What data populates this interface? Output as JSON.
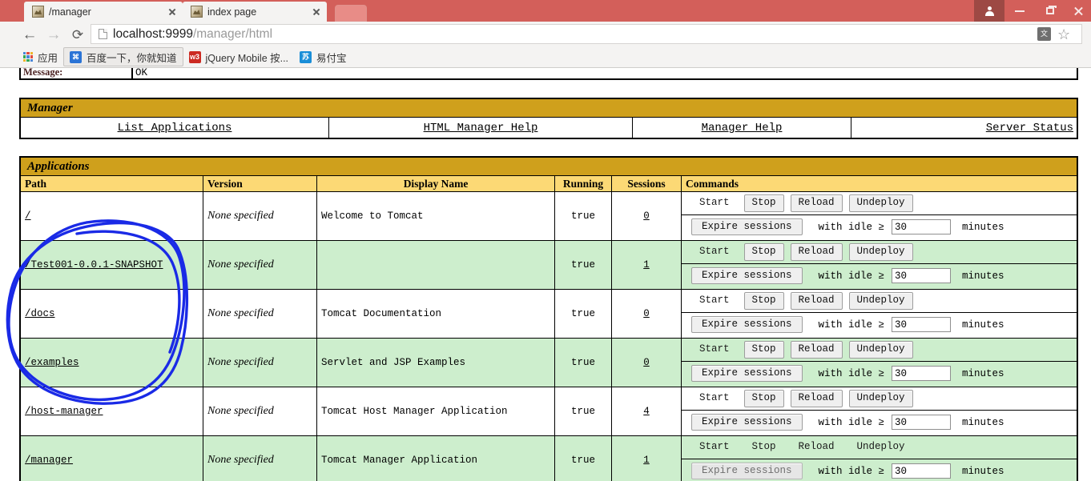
{
  "browser": {
    "tabs": [
      {
        "title": "/manager",
        "favicon": "tomcat-favicon",
        "active": true
      },
      {
        "title": "index page",
        "favicon": "tomcat-favicon",
        "active": false
      }
    ],
    "nav": {
      "back_icon": "back-arrow-icon",
      "forward_icon": "forward-arrow-icon",
      "reload_icon": "reload-icon",
      "back_glyph": "←",
      "forward_glyph": "→",
      "reload_glyph": "⟳"
    },
    "omnibox": {
      "url_host": "localhost:9999",
      "url_path": "/manager/html",
      "page_icon": "document-icon",
      "translate_icon": "translate-icon",
      "star_icon": "bookmark-star-icon",
      "star_glyph": "☆"
    },
    "window_controls": {
      "user_icon": "user-avatar-icon",
      "minimize_icon": "minimize-icon",
      "maximize_icon": "maximize-icon",
      "close_icon": "close-icon"
    },
    "bookmarks": [
      {
        "label": "应用",
        "icon": "apps-grid-icon",
        "badge": ""
      },
      {
        "label": "百度一下，你就知道",
        "icon": "baidu-favicon",
        "badge": "⌘"
      },
      {
        "label": "jQuery Mobile 按...",
        "icon": "w3school-favicon",
        "badge": "w3"
      },
      {
        "label": "易付宝",
        "icon": "yifubao-favicon",
        "badge": "苏"
      }
    ]
  },
  "page": {
    "message_row": {
      "label": "Message:",
      "value": "OK"
    },
    "manager_section": {
      "title": "Manager",
      "links": [
        {
          "label": "List Applications",
          "align": "center"
        },
        {
          "label": "HTML Manager Help",
          "align": "center"
        },
        {
          "label": "Manager Help",
          "align": "center"
        },
        {
          "label": "Server Status",
          "align": "right"
        }
      ]
    },
    "applications_section": {
      "title": "Applications",
      "columns": [
        "Path",
        "Version",
        "Display Name",
        "Running",
        "Sessions",
        "Commands"
      ],
      "commands_labels": {
        "start": "Start",
        "stop": "Stop",
        "reload": "Reload",
        "undeploy": "Undeploy",
        "expire": "Expire sessions",
        "with_idle": "with idle ≥",
        "idle_value": "30",
        "minutes": "minutes"
      },
      "rows": [
        {
          "path": "/",
          "version": "None specified",
          "display_name": "Welcome to Tomcat",
          "running": "true",
          "sessions": "0",
          "stripe": "white",
          "start_enabled": false,
          "stop_enabled": true,
          "reload_enabled": true,
          "undeploy_enabled": true,
          "expire_enabled": true,
          "idle_value": "30"
        },
        {
          "path": "/Test001-0.0.1-SNAPSHOT",
          "version": "None specified",
          "display_name": "",
          "running": "true",
          "sessions": "1",
          "stripe": "green",
          "start_enabled": false,
          "stop_enabled": true,
          "reload_enabled": true,
          "undeploy_enabled": true,
          "expire_enabled": true,
          "idle_value": "30"
        },
        {
          "path": "/docs",
          "version": "None specified",
          "display_name": "Tomcat Documentation",
          "running": "true",
          "sessions": "0",
          "stripe": "white",
          "start_enabled": false,
          "stop_enabled": true,
          "reload_enabled": true,
          "undeploy_enabled": true,
          "expire_enabled": true,
          "idle_value": "30"
        },
        {
          "path": "/examples",
          "version": "None specified",
          "display_name": "Servlet and JSP Examples",
          "running": "true",
          "sessions": "0",
          "stripe": "green",
          "start_enabled": false,
          "stop_enabled": true,
          "reload_enabled": true,
          "undeploy_enabled": true,
          "expire_enabled": true,
          "idle_value": "30"
        },
        {
          "path": "/host-manager",
          "version": "None specified",
          "display_name": "Tomcat Host Manager Application",
          "running": "true",
          "sessions": "4",
          "stripe": "white",
          "start_enabled": false,
          "stop_enabled": true,
          "reload_enabled": true,
          "undeploy_enabled": true,
          "expire_enabled": true,
          "idle_value": "30"
        },
        {
          "path": "/manager",
          "version": "None specified",
          "display_name": "Tomcat Manager Application",
          "running": "true",
          "sessions": "1",
          "stripe": "green",
          "start_enabled": false,
          "stop_enabled": false,
          "reload_enabled": false,
          "undeploy_enabled": false,
          "expire_enabled": true,
          "idle_value": "30"
        }
      ]
    }
  },
  "annotation": {
    "type": "hand-drawn-ellipse",
    "color": "#1a2ae6",
    "targets": "/Test001-0.0.1-SNAPSHOT row"
  },
  "colors": {
    "chrome_frame": "#d35f5a",
    "section_bar_gold": "#cfa01c",
    "column_header": "#fcd975",
    "row_green": "#cdeecd",
    "row_white": "#ffffff",
    "annotation_blue": "#1a2ae6"
  }
}
